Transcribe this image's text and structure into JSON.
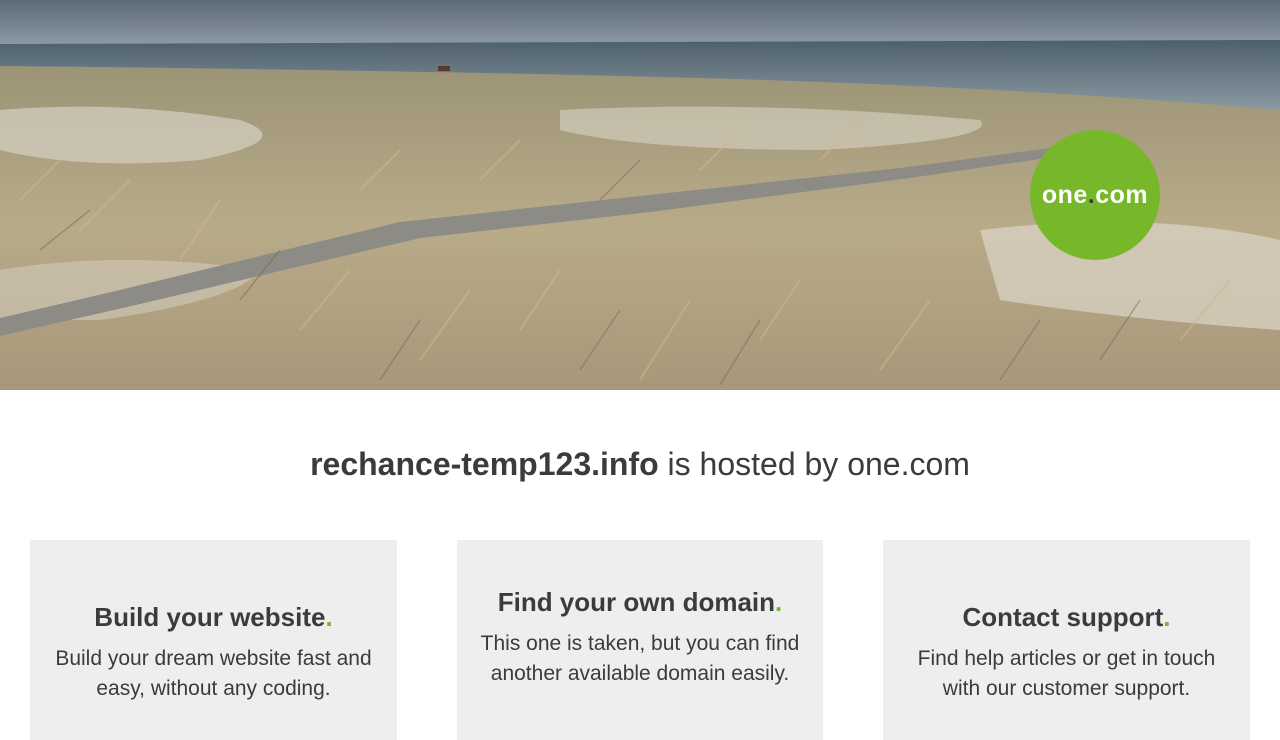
{
  "brand": {
    "logo_text_left": "one",
    "logo_dot": ".",
    "logo_text_right": "com",
    "logo_color": "#76b82a"
  },
  "headline": {
    "domain": "rechance-temp123.info",
    "suffix": " is hosted by one.com"
  },
  "cards": [
    {
      "title": "Build your website",
      "period": ".",
      "text": "Build your dream website fast and easy, without any coding."
    },
    {
      "title": "Find your own domain",
      "period": ".",
      "text": "This one is taken, but you can find another available domain easily."
    },
    {
      "title": "Contact support",
      "period": ".",
      "text": "Find help articles or get in touch with our customer support."
    }
  ]
}
